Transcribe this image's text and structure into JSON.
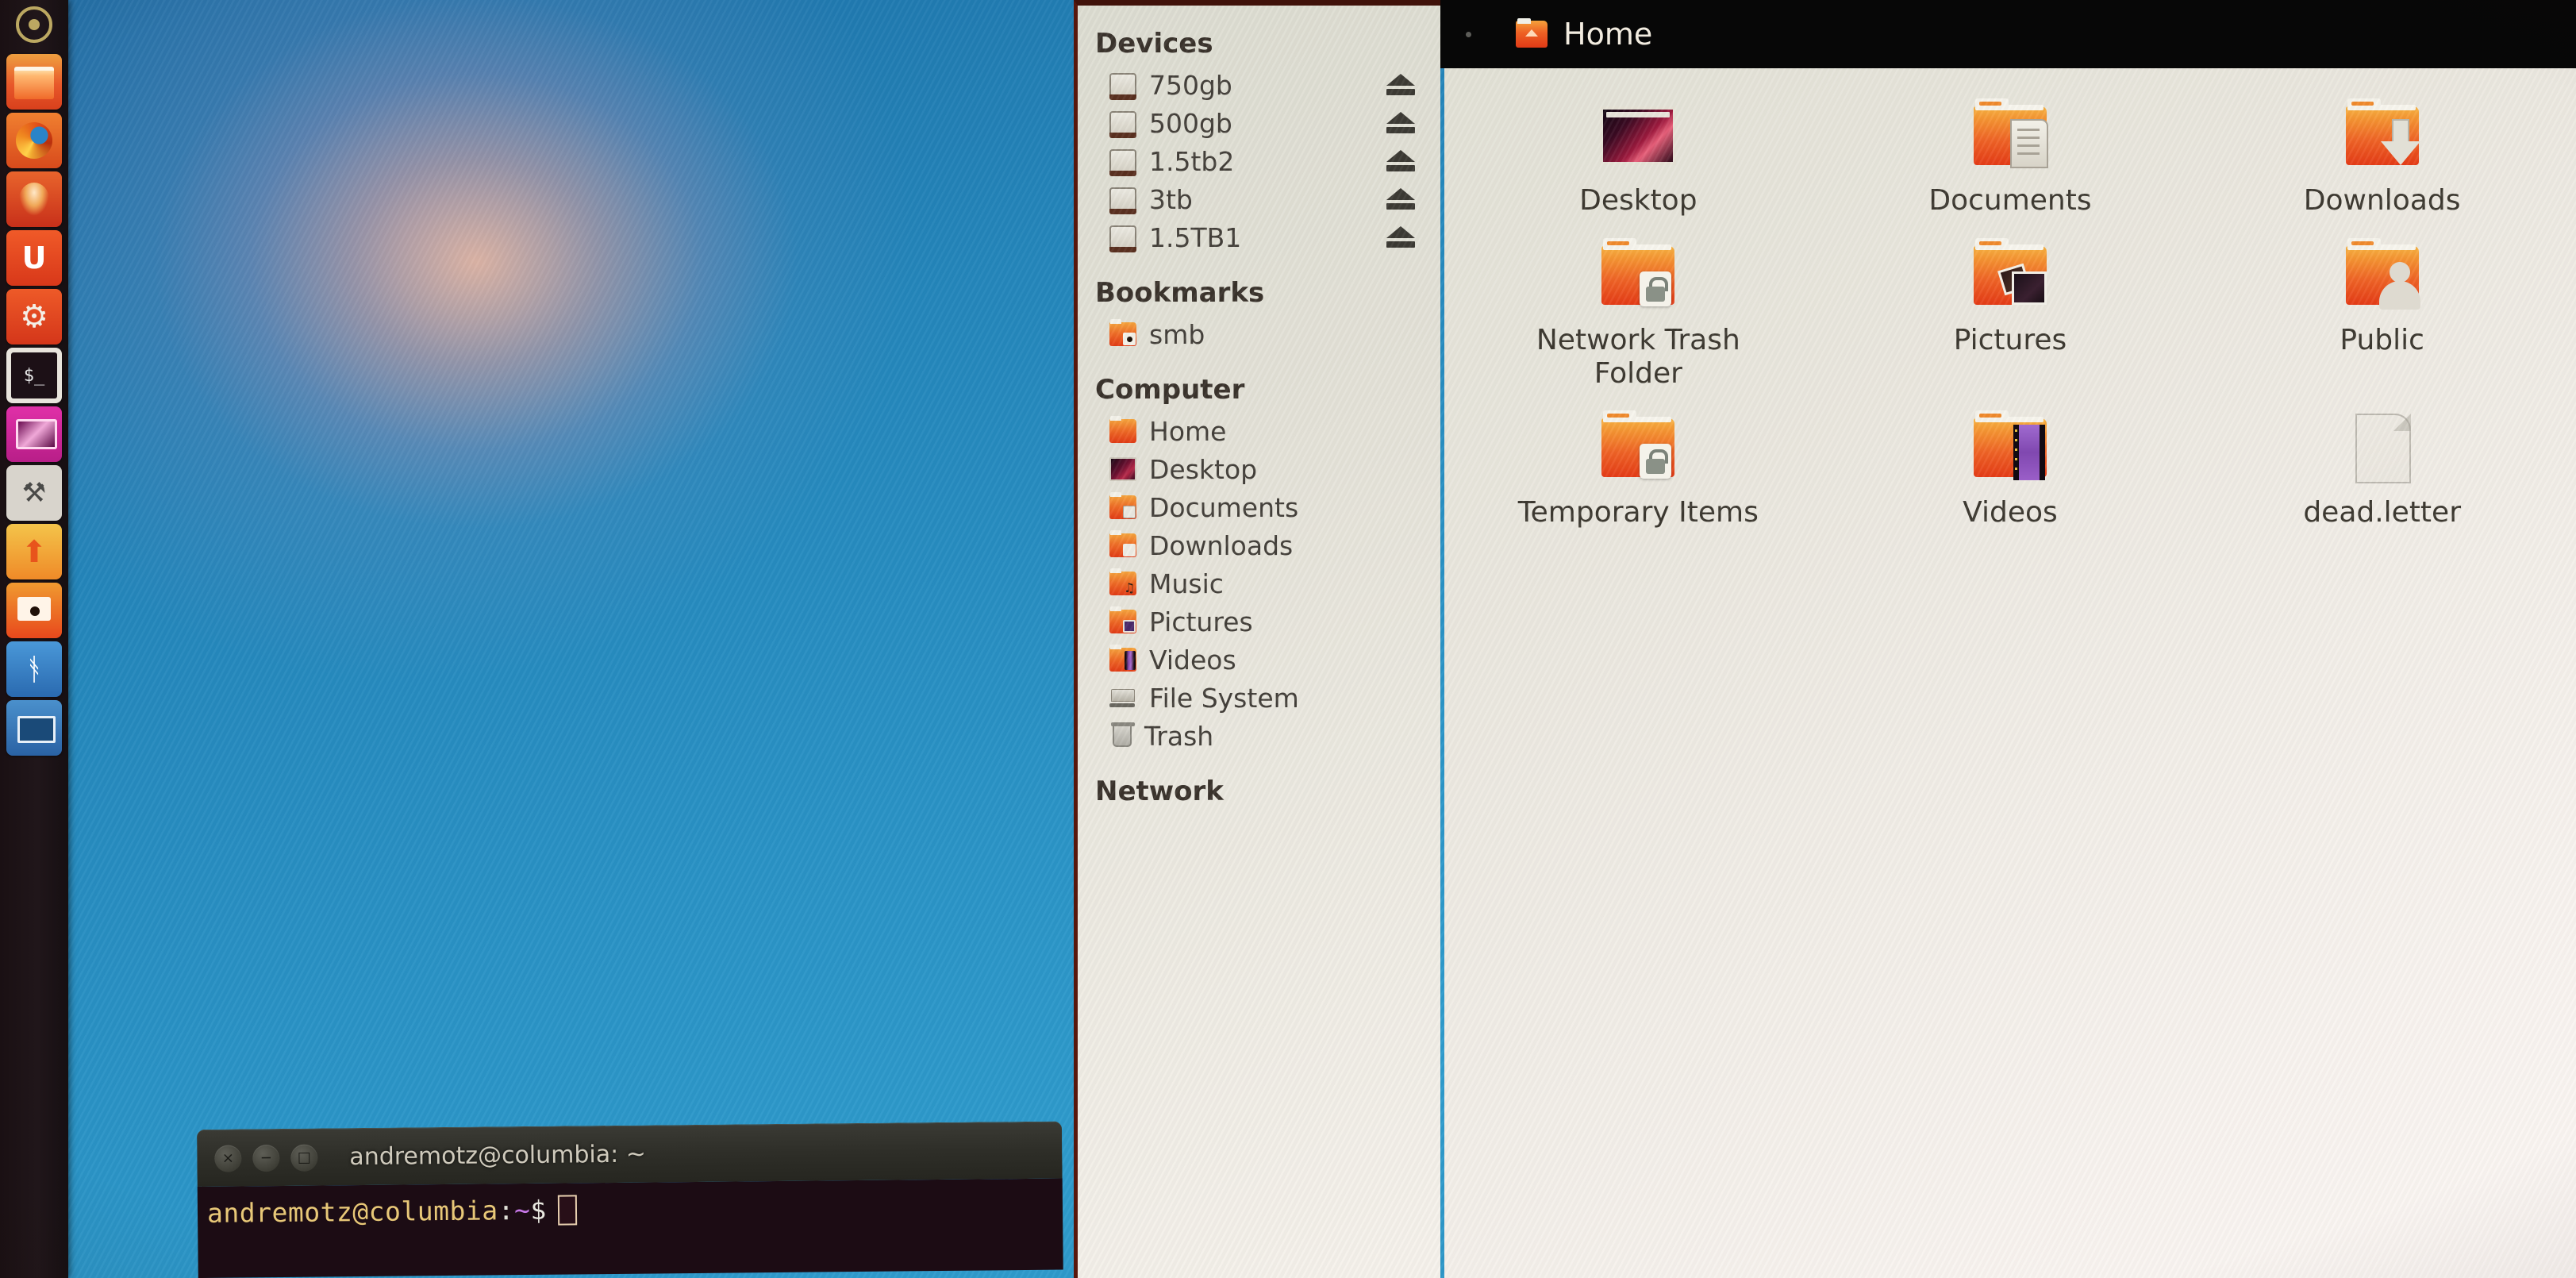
{
  "launcher": {
    "logo_name": "ubuntu-dash-logo",
    "items": [
      {
        "name": "files",
        "label": "Files",
        "icon": "files-icon"
      },
      {
        "name": "firefox",
        "label": "Firefox Web Browser",
        "icon": "firefox-icon"
      },
      {
        "name": "software",
        "label": "Ubuntu Software Center",
        "icon": "software-center-icon"
      },
      {
        "name": "ubuntu-one",
        "label": "Ubuntu One",
        "icon": "ubuntu-one-icon",
        "glyph": "U"
      },
      {
        "name": "settings",
        "label": "System Settings",
        "icon": "gear-icon",
        "glyph": "⚙"
      },
      {
        "name": "terminal",
        "label": "Terminal",
        "icon": "terminal-icon"
      },
      {
        "name": "remote-desktop",
        "label": "Remote Desktop",
        "icon": "remote-desktop-icon"
      },
      {
        "name": "tool",
        "label": "Tool",
        "icon": "wrench-icon",
        "glyph": "⚒"
      },
      {
        "name": "upload",
        "label": "Upload",
        "icon": "upload-arrow-icon",
        "glyph": "⬆"
      },
      {
        "name": "smb",
        "label": "smb",
        "icon": "smb-folder-icon"
      },
      {
        "name": "accessibility",
        "label": "Accessibility",
        "icon": "accessibility-icon",
        "glyph": "ᚬ"
      },
      {
        "name": "display",
        "label": "Display",
        "icon": "monitor-icon"
      }
    ]
  },
  "terminal": {
    "title": "andremotz@columbia: ~",
    "close_glyph": "×",
    "minimize_glyph": "−",
    "maximize_glyph": "□",
    "prompt_user": "andremotz@columbia",
    "prompt_sep": ":",
    "prompt_path": "~",
    "prompt_dollar": "$",
    "command": ""
  },
  "file_manager": {
    "breadcrumb": {
      "icon": "home-folder-icon",
      "label": "Home"
    },
    "sidebar": {
      "sections": [
        {
          "heading": "Devices",
          "items": [
            {
              "label": "750gb",
              "icon": "drive-icon",
              "eject": true
            },
            {
              "label": "500gb",
              "icon": "drive-icon",
              "eject": true
            },
            {
              "label": "1.5tb2",
              "icon": "drive-icon",
              "eject": true
            },
            {
              "label": "3tb",
              "icon": "drive-icon",
              "eject": true
            },
            {
              "label": "1.5TB1",
              "icon": "drive-icon",
              "eject": true
            }
          ]
        },
        {
          "heading": "Bookmarks",
          "items": [
            {
              "label": "smb",
              "icon": "smb-folder-icon",
              "eject": false
            }
          ]
        },
        {
          "heading": "Computer",
          "items": [
            {
              "label": "Home",
              "icon": "home-folder-icon",
              "eject": false
            },
            {
              "label": "Desktop",
              "icon": "desktop-thumb-icon",
              "eject": false
            },
            {
              "label": "Documents",
              "icon": "documents-folder-icon",
              "eject": false
            },
            {
              "label": "Downloads",
              "icon": "downloads-folder-icon",
              "eject": false
            },
            {
              "label": "Music",
              "icon": "music-folder-icon",
              "eject": false
            },
            {
              "label": "Pictures",
              "icon": "pictures-folder-icon",
              "eject": false
            },
            {
              "label": "Videos",
              "icon": "videos-folder-icon",
              "eject": false
            },
            {
              "label": "File System",
              "icon": "filesystem-icon",
              "eject": false
            },
            {
              "label": "Trash",
              "icon": "trash-icon",
              "eject": false
            }
          ]
        },
        {
          "heading": "Network",
          "items": []
        }
      ]
    },
    "items": [
      {
        "label": "Desktop",
        "icon": "desktop-thumbnail"
      },
      {
        "label": "Documents",
        "icon": "documents-folder"
      },
      {
        "label": "Downloads",
        "icon": "downloads-folder"
      },
      {
        "label": "Network Trash Folder",
        "icon": "locked-folder"
      },
      {
        "label": "Pictures",
        "icon": "pictures-folder"
      },
      {
        "label": "Public",
        "icon": "public-folder"
      },
      {
        "label": "Temporary Items",
        "icon": "locked-folder"
      },
      {
        "label": "Videos",
        "icon": "videos-folder"
      },
      {
        "label": "dead.letter",
        "icon": "text-file"
      }
    ]
  },
  "cursor": {
    "name": "mouse-pointer"
  },
  "colors": {
    "ubuntu_orange": "#ee6024",
    "launcher_bg": "#1f151a",
    "sidebar_bg": "#e8e5dc",
    "content_bg": "#f2eee8",
    "header_black": "#070707",
    "desktop_blue": "#2a8cc0",
    "terminal_bg": "#1c0c14"
  }
}
